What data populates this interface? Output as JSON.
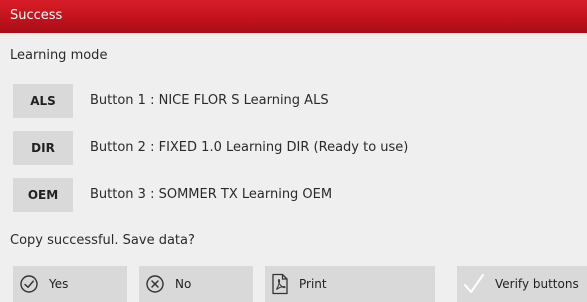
{
  "window": {
    "title": "Success"
  },
  "section": {
    "heading": "Learning mode"
  },
  "rows": [
    {
      "button": "ALS",
      "text": "Button 1 : NICE FLOR S Learning ALS"
    },
    {
      "button": "DIR",
      "text": "Button 2 : FIXED 1.0 Learning DIR (Ready to use)"
    },
    {
      "button": "OEM",
      "text": "Button 3 : SOMMER TX Learning OEM"
    }
  ],
  "question": "Copy successful. Save data?",
  "actions": {
    "yes": {
      "label": "Yes",
      "icon": "check-circle-icon"
    },
    "no": {
      "label": "No",
      "icon": "x-circle-icon"
    },
    "print": {
      "label": "Print",
      "icon": "pdf-document-icon"
    },
    "verify": {
      "label": "Verify buttons",
      "icon": "checkmark-icon"
    }
  },
  "colors": {
    "titlebar": "#c8141e",
    "background": "#efefef",
    "button": "#d9d9d9"
  }
}
